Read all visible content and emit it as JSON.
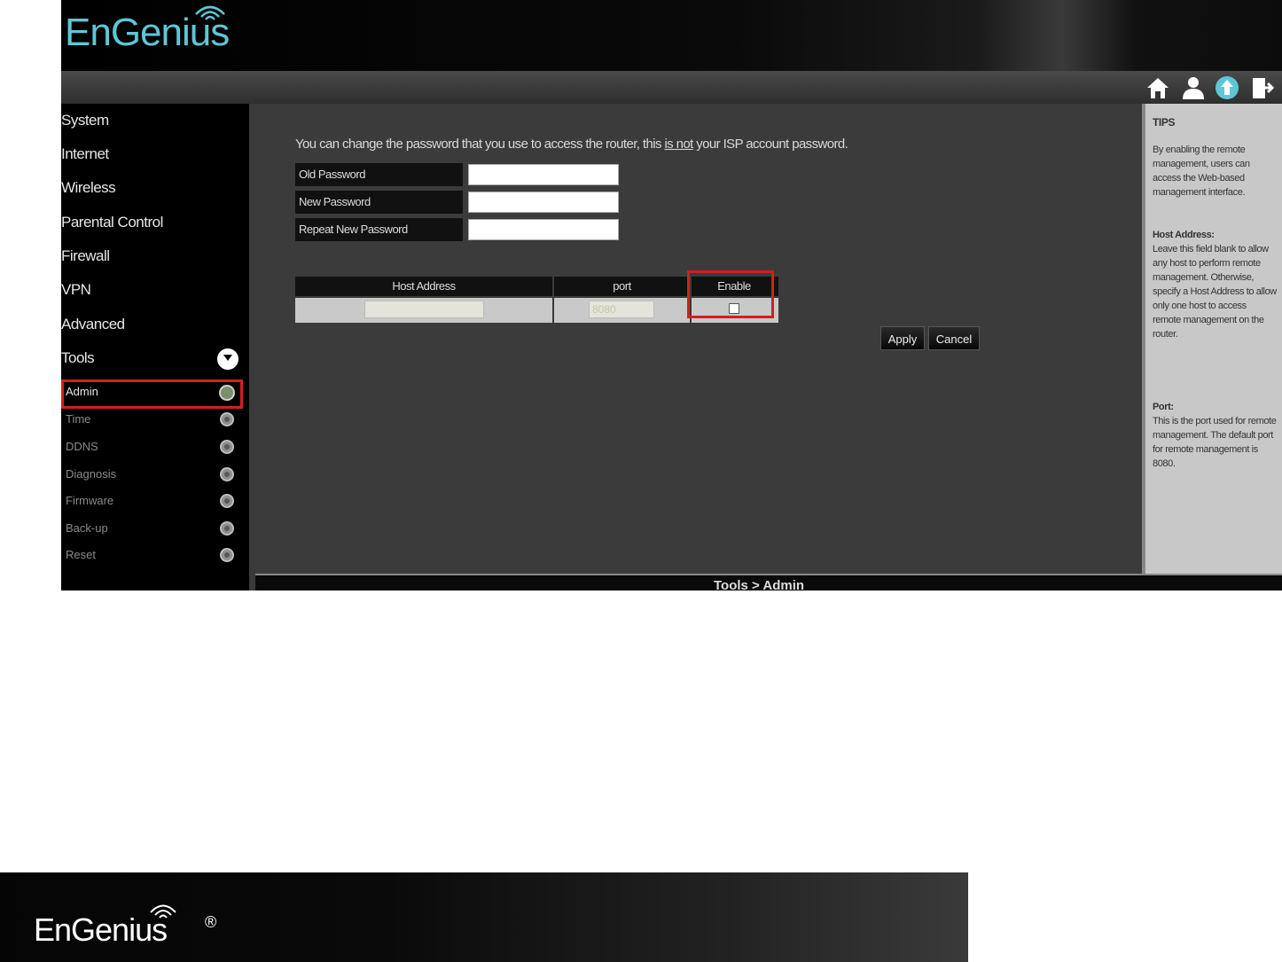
{
  "brand": {
    "name": "EnGenius",
    "registered": "®"
  },
  "toolbar": {
    "icons": [
      "home-icon",
      "user-icon",
      "upload-icon",
      "logout-icon"
    ]
  },
  "sidebar": {
    "items": [
      {
        "label": "System"
      },
      {
        "label": "Internet"
      },
      {
        "label": "Wireless"
      },
      {
        "label": "Parental Control"
      },
      {
        "label": "Firewall"
      },
      {
        "label": "VPN"
      },
      {
        "label": "Advanced"
      },
      {
        "label": "Tools"
      }
    ],
    "sub_items": [
      {
        "label": "Admin",
        "selected": true
      },
      {
        "label": "Time"
      },
      {
        "label": "DDNS"
      },
      {
        "label": "Diagnosis"
      },
      {
        "label": "Firmware"
      },
      {
        "label": "Back-up"
      },
      {
        "label": "Reset"
      }
    ]
  },
  "main": {
    "intro_before": "You can change the password that you use to access the router, this ",
    "intro_emph": "is not",
    "intro_after": " your ISP account password.",
    "password_fields": [
      {
        "label": "Old Password",
        "value": ""
      },
      {
        "label": "New Password",
        "value": ""
      },
      {
        "label": "Repeat New Password",
        "value": ""
      }
    ],
    "remote_table": {
      "headers": {
        "host": "Host Address",
        "port": "port",
        "enable": "Enable"
      },
      "host_value": "",
      "port_value": "8080",
      "enabled": false
    },
    "apply_label": "Apply",
    "cancel_label": "Cancel",
    "breadcrumb": "Tools > Admin"
  },
  "tips": {
    "title": "TIPS",
    "intro": "By enabling the remote management, users can access the Web-based management interface.",
    "host_title": "Host Address:",
    "host_text": "Leave this field blank to allow any host to perform remote management. Otherwise, specify a Host Address to allow only one host to access remote management on the router.",
    "port_title": "Port:",
    "port_text": "This is the port used for remote management. The default port for remote management is 8080."
  },
  "colors": {
    "accent": "#5ec6d6",
    "highlight": "#d41e1e"
  }
}
